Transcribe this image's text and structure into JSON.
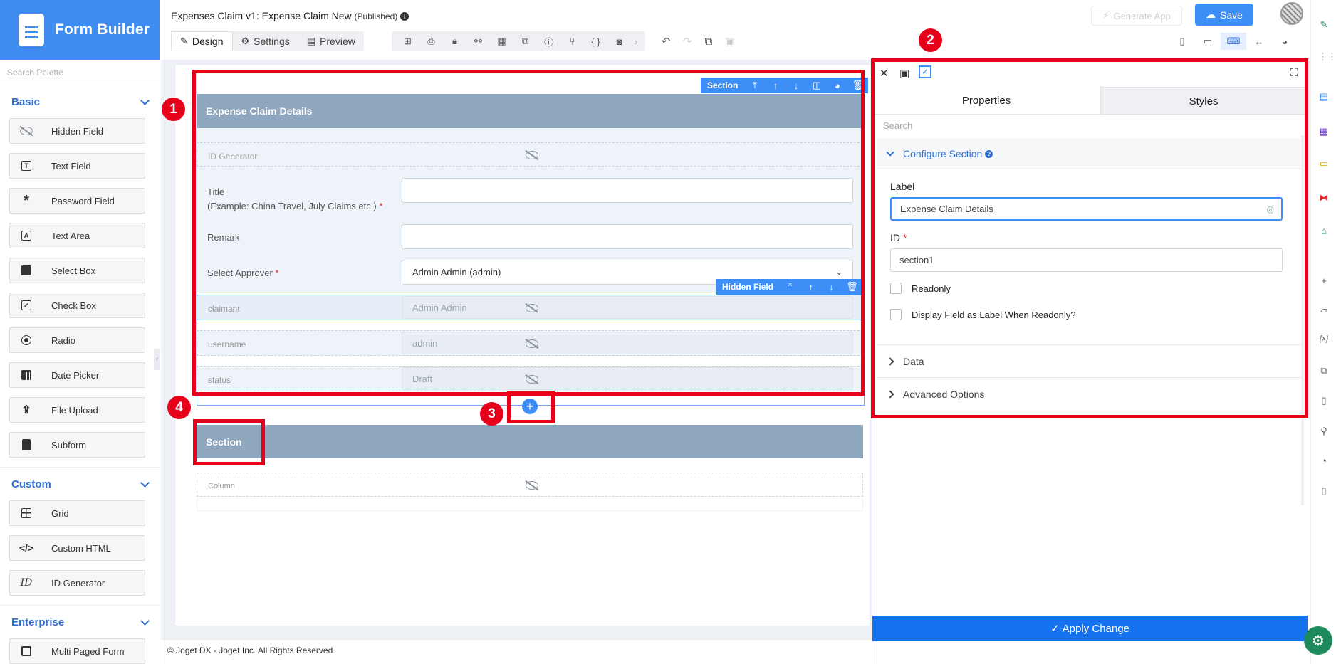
{
  "app": {
    "brand": "Form Builder"
  },
  "palette": {
    "search_placeholder": "Search Palette",
    "groups": [
      {
        "label": "Basic",
        "items": [
          "Hidden Field",
          "Text Field",
          "Password Field",
          "Text Area",
          "Select Box",
          "Check Box",
          "Radio",
          "Date Picker",
          "File Upload",
          "Subform"
        ]
      },
      {
        "label": "Custom",
        "items": [
          "Grid",
          "Custom HTML",
          "ID Generator"
        ]
      },
      {
        "label": "Enterprise",
        "items": [
          "Multi Paged Form"
        ]
      }
    ]
  },
  "header": {
    "form_title": "Expenses Claim v1: Expense Claim New",
    "form_status": "(Published)",
    "tabs": [
      {
        "label": "Design",
        "active": true
      },
      {
        "label": "Settings"
      },
      {
        "label": "Preview"
      }
    ],
    "generate_app": "Generate App",
    "save": "Save"
  },
  "canvas": {
    "section_toolbar_label": "Section",
    "section1": {
      "title": "Expense Claim Details",
      "id_generator_label": "ID Generator",
      "title_label": "Title",
      "title_hint": "(Example: China Travel, July Claims etc.)",
      "required_mark": "*",
      "remark_label": "Remark",
      "approver_label": "Select Approver",
      "approver_value": "Admin Admin (admin)",
      "hidden_toolbar_label": "Hidden Field",
      "hidden_rows": [
        {
          "label": "claimant",
          "value": "Admin Admin"
        },
        {
          "label": "username",
          "value": "admin"
        },
        {
          "label": "status",
          "value": "Draft"
        }
      ]
    },
    "section2": {
      "title": "Section",
      "column_label": "Column"
    }
  },
  "annotations": [
    "1",
    "2",
    "3",
    "4"
  ],
  "footer": {
    "text": "© Joget DX - Joget Inc. All Rights Reserved."
  },
  "properties": {
    "tabs": [
      "Properties",
      "Styles"
    ],
    "search_placeholder": "Search",
    "configure_section": "Configure Section",
    "label_field": {
      "label": "Label",
      "value": "Expense Claim Details"
    },
    "id_field": {
      "label": "ID",
      "required": "*",
      "value": "section1"
    },
    "readonly": "Readonly",
    "display_as_label": "Display Field as Label When Readonly?",
    "data": "Data",
    "advanced": "Advanced Options",
    "apply": "Apply Change"
  },
  "colors": {
    "accent": "#3e8ef7",
    "annotation": "#e6001a",
    "section_header": "#8fa6bf",
    "apply": "#1673f0"
  }
}
